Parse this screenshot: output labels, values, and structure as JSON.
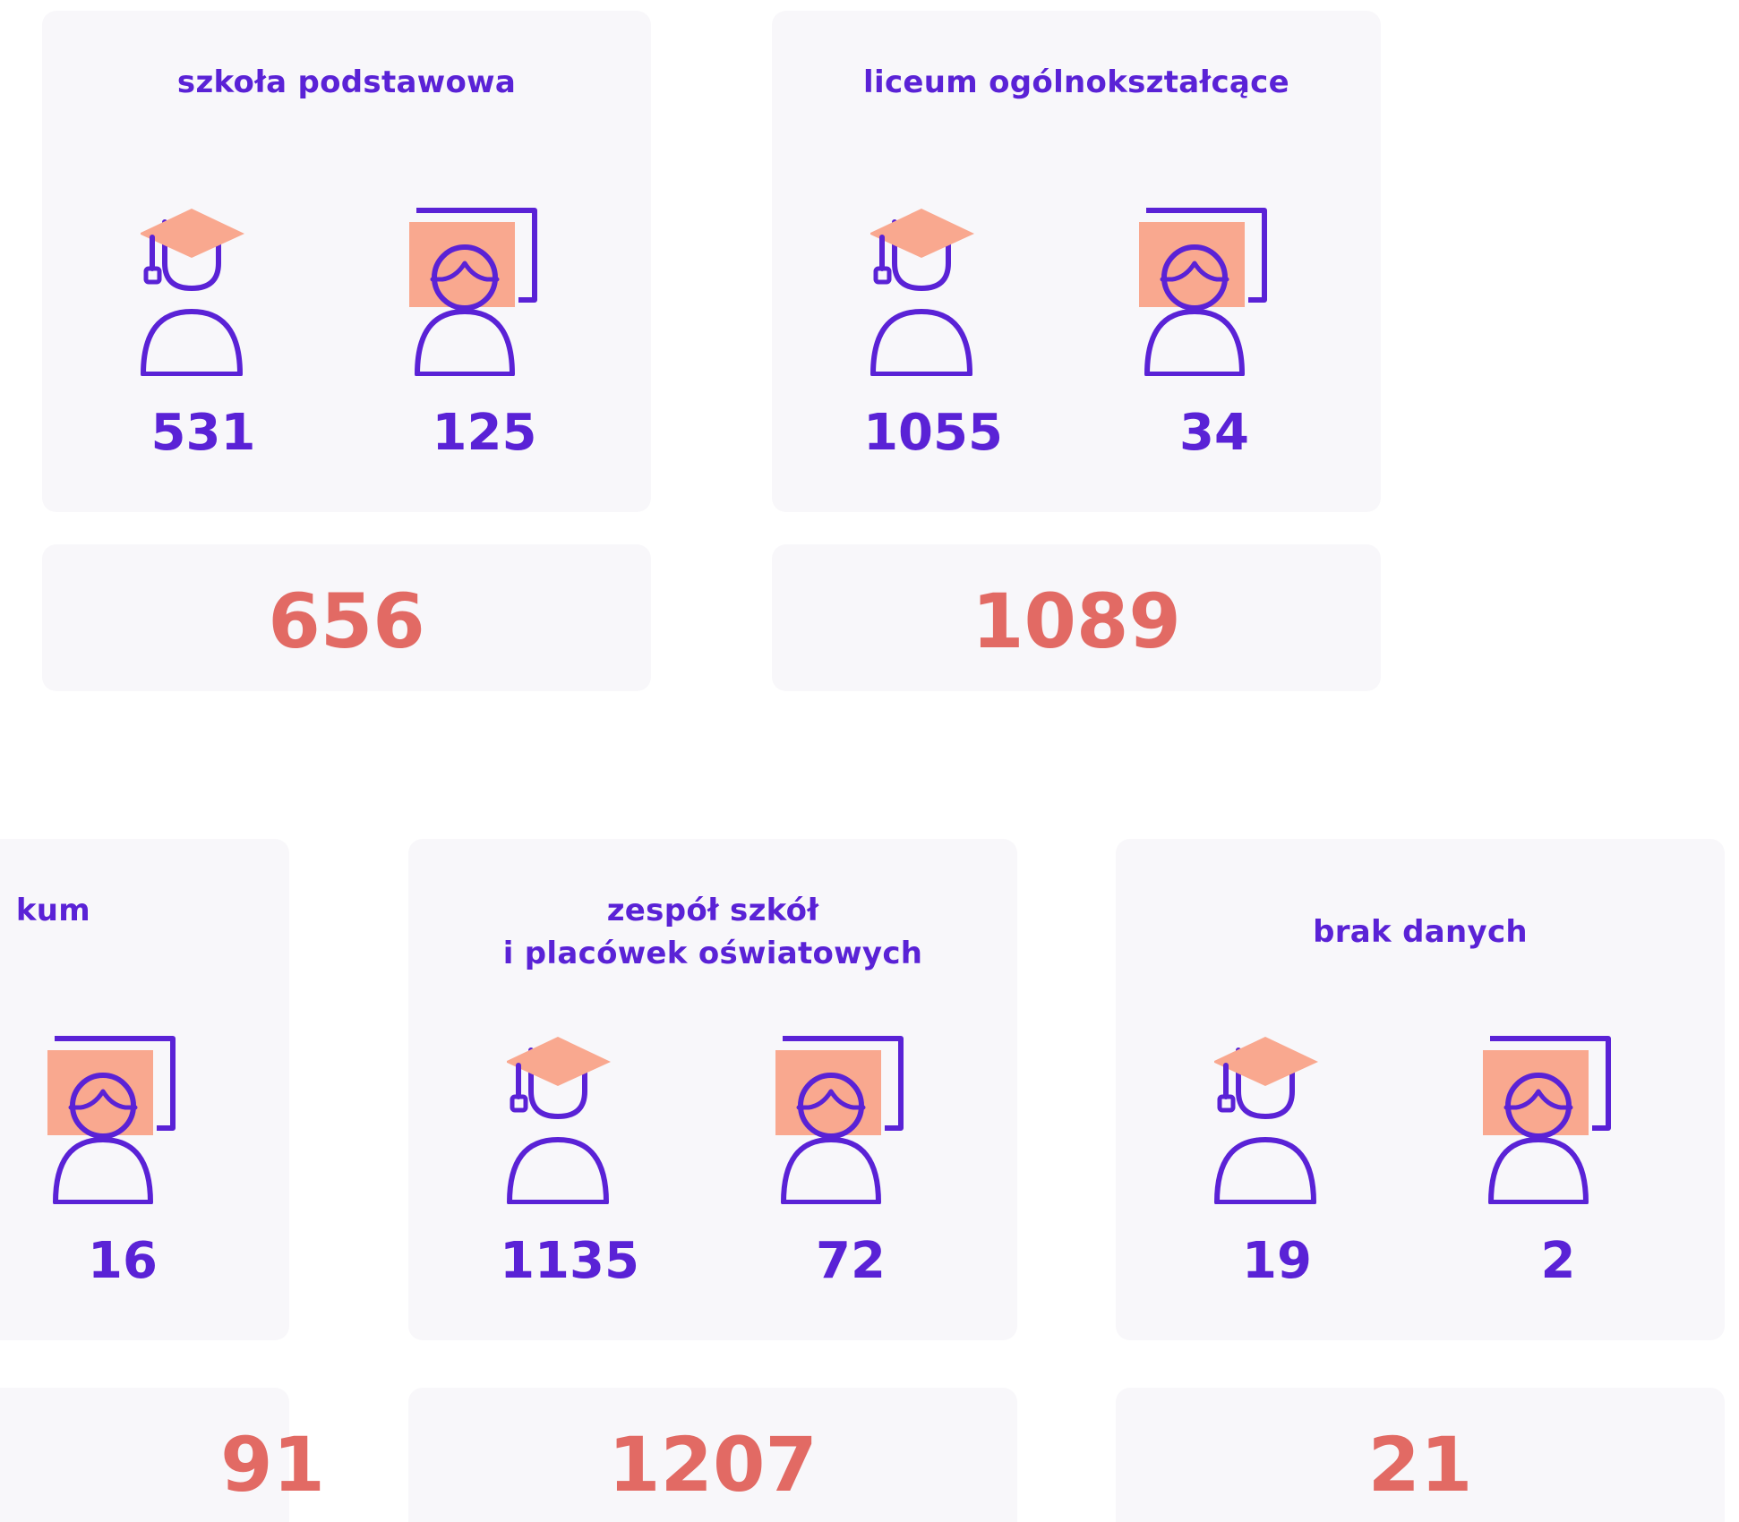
{
  "colors": {
    "card_background": "#f8f7fa",
    "primary_purple": "#5a22d6",
    "salmon_accent": "#f9a88f",
    "total_red": "#e26a64"
  },
  "icons": {
    "student": "graduate-cap-student-icon",
    "teacher": "teacher-at-board-icon"
  },
  "groups": [
    {
      "title_line1": "szkoła podstawowa",
      "title_line2": "",
      "students": "531",
      "teachers": "125",
      "total": "656"
    },
    {
      "title_line1": "liceum ogólnokształcące",
      "title_line2": "",
      "students": "1055",
      "teachers": "34",
      "total": "1089"
    },
    {
      "title_line1": "kum",
      "title_line2": "",
      "students": "",
      "teachers": "16",
      "total": "91"
    },
    {
      "title_line1": "zespół szkół",
      "title_line2": "i placówek oświatowych",
      "students": "1135",
      "teachers": "72",
      "total": "1207"
    },
    {
      "title_line1": "brak danych",
      "title_line2": "",
      "students": "19",
      "teachers": "2",
      "total": "21"
    }
  ]
}
